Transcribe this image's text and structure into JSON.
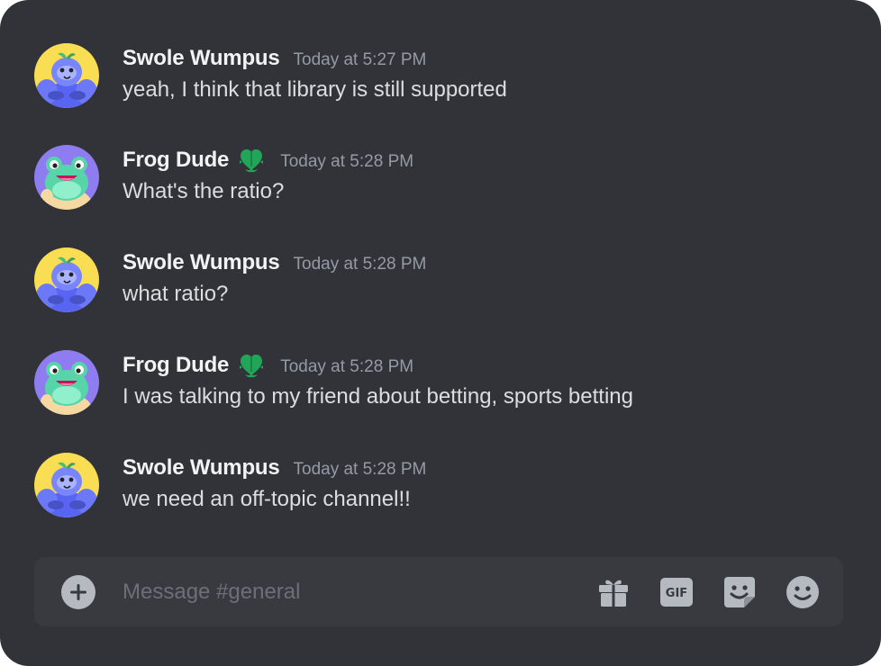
{
  "channel": "general",
  "messages": [
    {
      "author": "Swole Wumpus",
      "avatar": "wumpus-avatar",
      "timestamp": "Today at 5:27 PM",
      "text": "yeah, I think that library is still supported",
      "badge": null
    },
    {
      "author": "Frog Dude",
      "avatar": "frog-avatar",
      "timestamp": "Today at 5:28 PM",
      "text": "What's the ratio?",
      "badge": "green-heart-leaf-icon"
    },
    {
      "author": "Swole Wumpus",
      "avatar": "wumpus-avatar",
      "timestamp": "Today at 5:28 PM",
      "text": "what ratio?",
      "badge": null
    },
    {
      "author": "Frog Dude",
      "avatar": "frog-avatar",
      "timestamp": "Today at 5:28 PM",
      "text": "I was talking to my friend about betting, sports betting",
      "badge": "green-heart-leaf-icon"
    },
    {
      "author": "Swole Wumpus",
      "avatar": "wumpus-avatar",
      "timestamp": "Today at 5:28 PM",
      "text": "we need an off-topic channel!!",
      "badge": null
    }
  ],
  "composer": {
    "placeholder": "Message #general",
    "value": "",
    "add_icon": "plus-circle-icon",
    "tools": [
      {
        "name": "gift-icon"
      },
      {
        "name": "gif-icon",
        "label": "GIF"
      },
      {
        "name": "sticker-icon"
      },
      {
        "name": "emoji-icon"
      }
    ]
  },
  "colors": {
    "background": "#313338",
    "composer": "#383a40",
    "username": "#f2f3f5",
    "message_text": "#dbdee1",
    "timestamp": "#949ba4",
    "icon": "#b5bac1",
    "placeholder": "#6d6f78",
    "badge_green": "#23a559"
  }
}
